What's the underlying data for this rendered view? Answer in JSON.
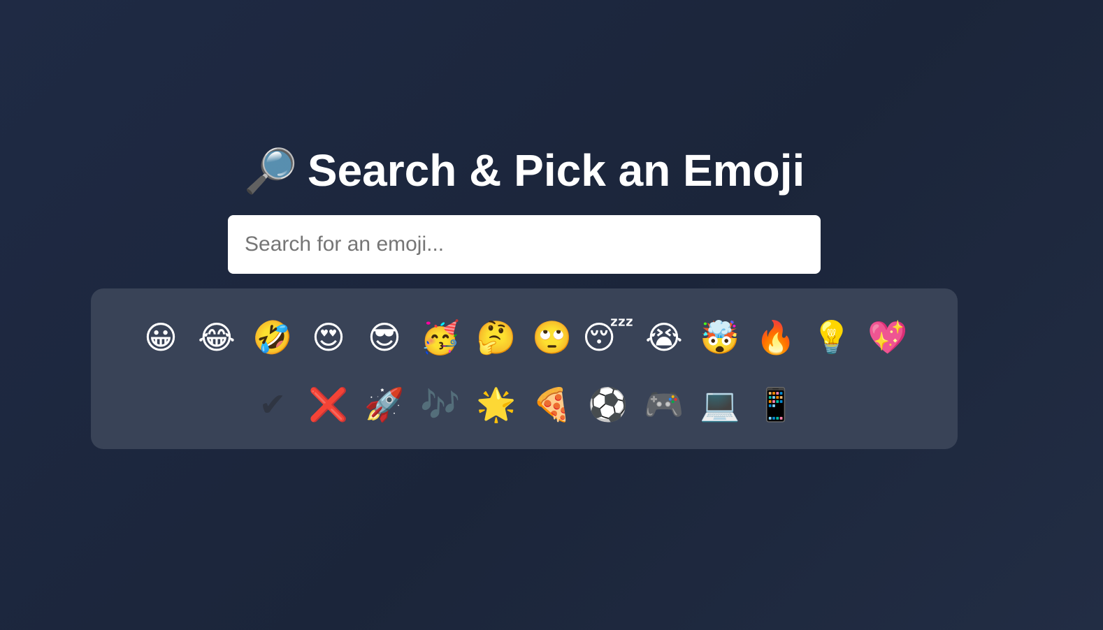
{
  "header": {
    "icon": "🔎",
    "icon_name": "magnifier-icon",
    "title": "Search & Pick an Emoji"
  },
  "search": {
    "value": "",
    "placeholder": "Search for an emoji..."
  },
  "emoji_grid": {
    "items": [
      {
        "glyph": "😀",
        "name": "grinning-face"
      },
      {
        "glyph": "😂",
        "name": "tears-of-joy"
      },
      {
        "glyph": "🤣",
        "name": "rolling-on-floor-laughing"
      },
      {
        "glyph": "😍",
        "name": "heart-eyes"
      },
      {
        "glyph": "😎",
        "name": "sunglasses-face"
      },
      {
        "glyph": "🥳",
        "name": "partying-face"
      },
      {
        "glyph": "🤔",
        "name": "thinking-face"
      },
      {
        "glyph": "🙄",
        "name": "eye-roll"
      },
      {
        "glyph": "😴",
        "name": "sleeping-face"
      },
      {
        "glyph": "😭",
        "name": "loudly-crying"
      },
      {
        "glyph": "🤯",
        "name": "exploding-head"
      },
      {
        "glyph": "🔥",
        "name": "fire"
      },
      {
        "glyph": "💡",
        "name": "light-bulb"
      },
      {
        "glyph": "💖",
        "name": "sparkling-heart"
      },
      {
        "glyph": "✔",
        "name": "check-mark"
      },
      {
        "glyph": "❌",
        "name": "cross-mark"
      },
      {
        "glyph": "🚀",
        "name": "rocket"
      },
      {
        "glyph": "🎶",
        "name": "musical-notes"
      },
      {
        "glyph": "🌟",
        "name": "glowing-star"
      },
      {
        "glyph": "🍕",
        "name": "pizza"
      },
      {
        "glyph": "⚽",
        "name": "soccer-ball"
      },
      {
        "glyph": "🎮",
        "name": "game-controller"
      },
      {
        "glyph": "💻",
        "name": "laptop"
      },
      {
        "glyph": "📱",
        "name": "mobile-phone"
      }
    ]
  },
  "colors": {
    "background": "#1f2a44",
    "panel": "#394357",
    "input_bg": "#ffffff",
    "title": "#ffffff"
  }
}
